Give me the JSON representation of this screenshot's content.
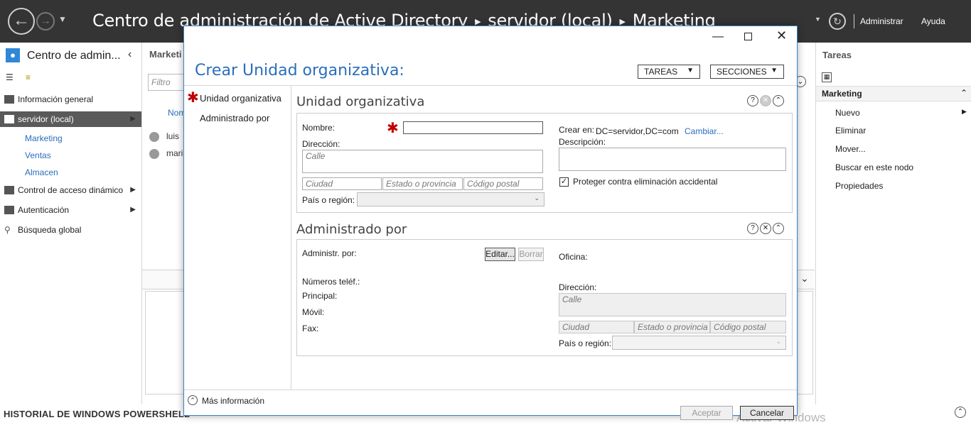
{
  "topbar": {
    "title_root": "Centro de administración de Active Directory",
    "title_server": "servidor (local)",
    "title_node": "Marketing",
    "menu_admin": "Administrar",
    "menu_help": "Ayuda"
  },
  "leftnav": {
    "header": "Centro de admin...",
    "items": [
      {
        "label": "Información general"
      },
      {
        "label": "servidor (local)"
      },
      {
        "label": "Control de acceso dinámico"
      },
      {
        "label": "Autenticación"
      },
      {
        "label": "Búsqueda global"
      }
    ],
    "subitems": [
      "Marketing",
      "Ventas",
      "Almacen"
    ]
  },
  "middle": {
    "header": "Marketi",
    "filter_placeholder": "Filtro",
    "column_name": "Nom",
    "users": [
      "luis",
      "mari"
    ]
  },
  "tasks": {
    "title": "Tareas",
    "section": "Marketing",
    "items": [
      "Nuevo",
      "Eliminar",
      "Mover...",
      "Buscar en este nodo",
      "Propiedades"
    ]
  },
  "bottom": {
    "powershell": "HISTORIAL DE WINDOWS POWERSHELL",
    "watermark": "Activar Windows"
  },
  "dialog": {
    "title": "Crear Unidad organizativa:",
    "tasks_dd": "TAREAS",
    "sections_dd": "SECCIONES",
    "nav": [
      "Unidad organizativa",
      "Administrado por"
    ],
    "more_info": "Más información",
    "ok": "Aceptar",
    "cancel": "Cancelar",
    "ou": {
      "title": "Unidad organizativa",
      "name_label": "Nombre:",
      "name_value": "",
      "address_label": "Dirección:",
      "street_ph": "Calle",
      "city_ph": "Ciudad",
      "state_ph": "Estado o provincia",
      "zip_ph": "Código postal",
      "country_label": "País o región:",
      "create_in_label": "Crear en:",
      "create_in_value": "DC=servidor,DC=com",
      "change_link": "Cambiar...",
      "desc_label": "Descripción:",
      "protect_label": "Proteger contra eliminación accidental",
      "protect_checked": true
    },
    "mgr": {
      "title": "Administrado por",
      "managed_by_label": "Administr. por:",
      "edit_btn": "Editar...",
      "clear_btn": "Borrar",
      "office_label": "Oficina:",
      "phones_label": "Números teléf.:",
      "main_label": "Principal:",
      "mobile_label": "Móvil:",
      "fax_label": "Fax:",
      "address_label": "Dirección:",
      "street_ph": "Calle",
      "city_ph": "Ciudad",
      "state_ph": "Estado o provincia",
      "zip_ph": "Código postal",
      "country_label": "País o región:"
    }
  }
}
